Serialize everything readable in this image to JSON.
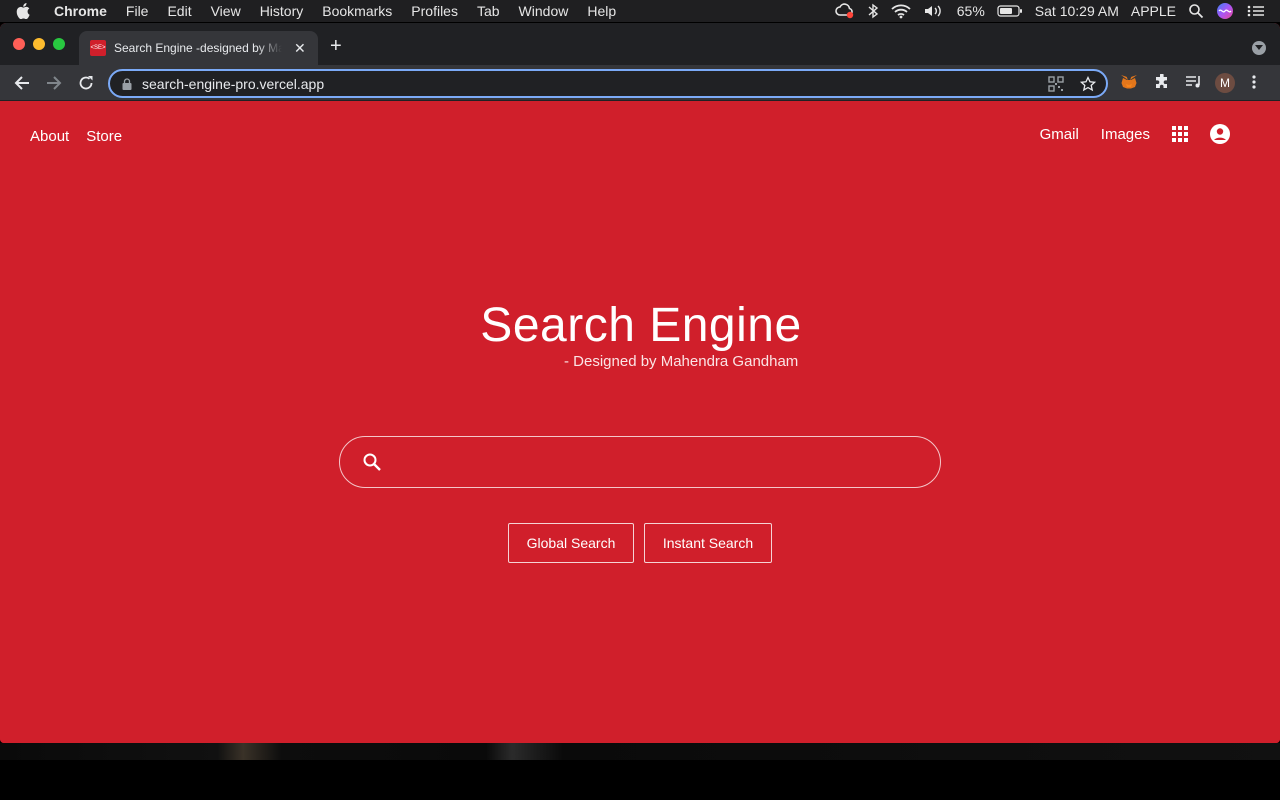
{
  "menubar": {
    "app_name": "Chrome",
    "menus": [
      "File",
      "Edit",
      "View",
      "History",
      "Bookmarks",
      "Profiles",
      "Tab",
      "Window",
      "Help"
    ],
    "battery": "65%",
    "clock": "Sat 10:29 AM",
    "user": "APPLE"
  },
  "browser": {
    "tab_title": "Search Engine -designed by Mahendra Gandham",
    "favicon_text": "<SE>",
    "url": "search-engine-pro.vercel.app",
    "profile_initial": "M"
  },
  "page": {
    "nav_left": [
      "About",
      "Store"
    ],
    "nav_right": {
      "gmail": "Gmail",
      "images": "Images"
    },
    "logo_title": "Search Engine",
    "logo_subtitle": "- Designed by Mahendra Gandham",
    "search_value": "",
    "buttons": {
      "global": "Global Search",
      "instant": "Instant Search"
    },
    "background_color": "#d01f2b"
  }
}
